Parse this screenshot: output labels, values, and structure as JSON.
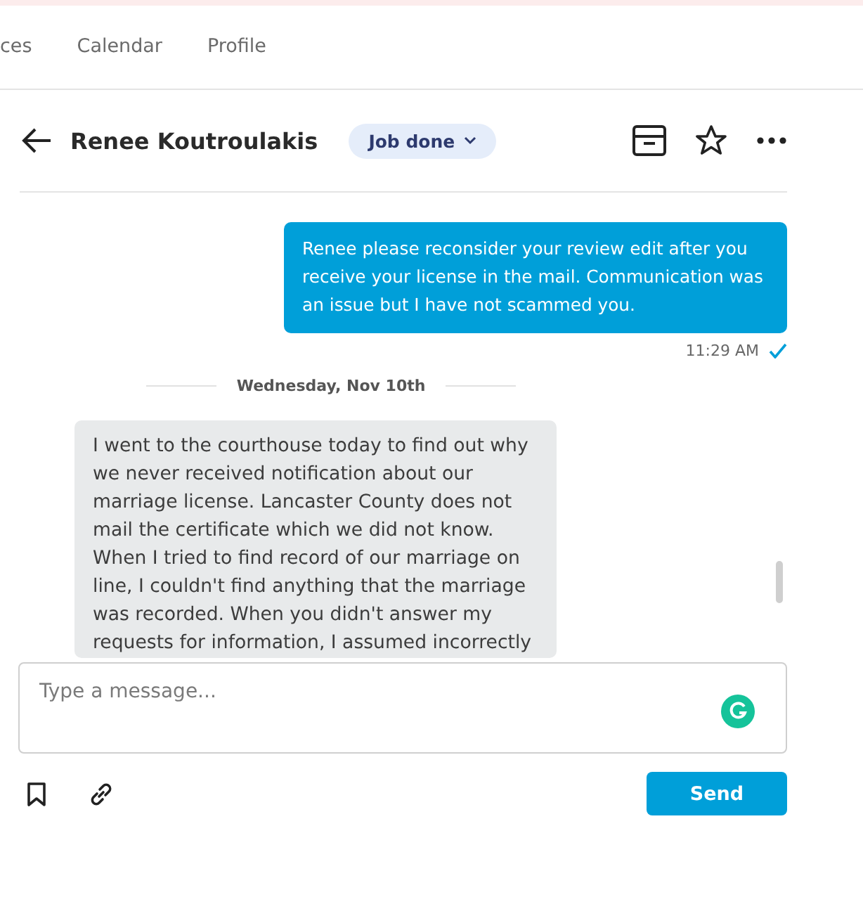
{
  "nav": {
    "tabs": [
      {
        "label": "ces",
        "selected": false
      },
      {
        "label": "Calendar",
        "selected": false
      },
      {
        "label": "Profile",
        "selected": false
      }
    ]
  },
  "header": {
    "contact": "Renee Koutroulakis",
    "status": "Job done",
    "starred": false
  },
  "messages": [
    {
      "kind": "sent",
      "text": "Renee please reconsider your review edit after you receive your license in the mail. Communication was an issue but I have not scammed you.",
      "time": "11:29 AM",
      "read": true
    },
    {
      "kind": "divider",
      "text": "Wednesday, Nov 10th"
    },
    {
      "kind": "received",
      "text": "I went to the courthouse today to find out why we never received notification about our marriage license. Lancaster County does not mail the certificate which we did not know. When I tried to find record of our marriage on line, I couldn't find anything that the marriage was recorded. When you didn't answer my requests for information, I assumed incorrectly"
    }
  ],
  "composer": {
    "placeholder": "Type a message...",
    "send": "Send"
  }
}
